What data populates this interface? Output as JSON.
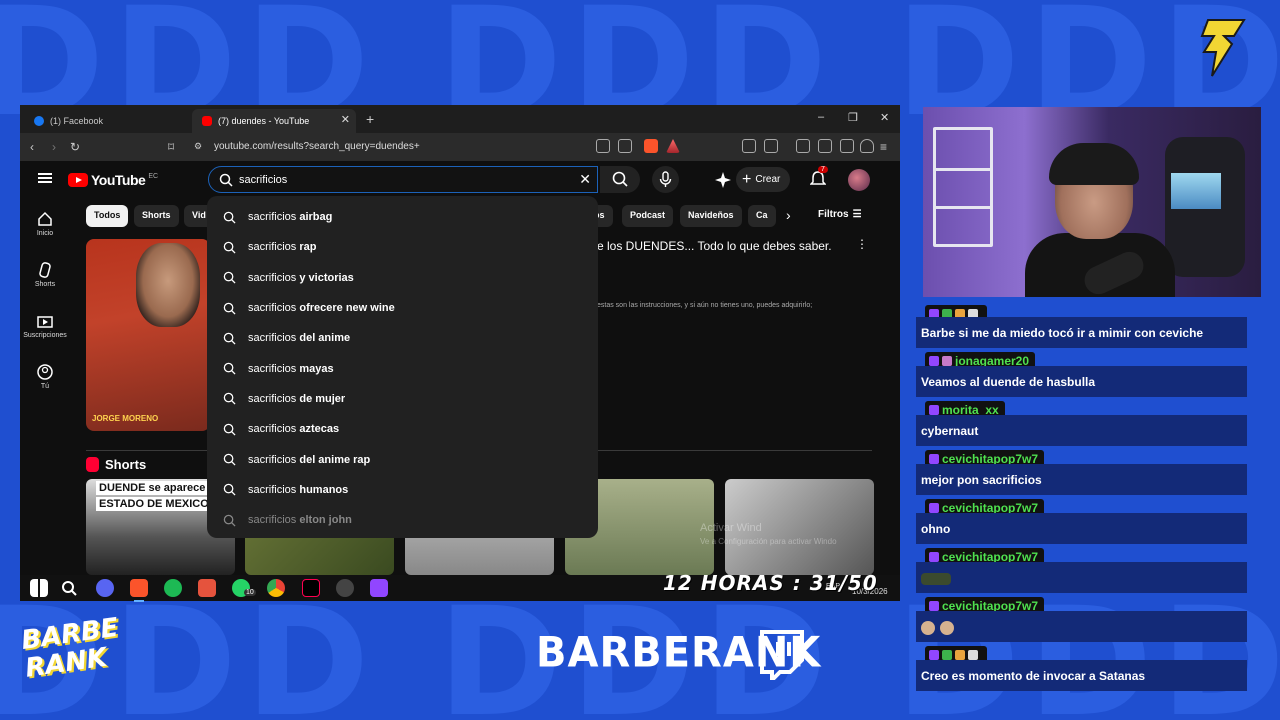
{
  "overlay": {
    "brand_name": "BARBERANK",
    "logo_line1": "BARBE",
    "logo_line2": "RANK",
    "bg_pattern": "DDD DDD DDD DDD",
    "accent_color": "#2b5ee0",
    "counter": "12 HORAS : 31/50"
  },
  "browser": {
    "tabs": [
      {
        "label": "(1) Facebook",
        "icon": "facebook-icon"
      },
      {
        "label": "(7) duendes - YouTube",
        "icon": "youtube-icon",
        "active": true
      }
    ],
    "url": "youtube.com/results?search_query=duendes+"
  },
  "youtube": {
    "logo_text": "YouTube",
    "country": "EC",
    "search_value": "sacrificios",
    "create_label": "Crear",
    "notif_count": "7",
    "nav": [
      {
        "label": "Inicio",
        "icon": "home-icon"
      },
      {
        "label": "Shorts",
        "icon": "shorts-icon"
      },
      {
        "label": "Suscripciones",
        "icon": "subscriptions-icon"
      },
      {
        "label": "Tú",
        "icon": "you-icon"
      }
    ],
    "chips": [
      "Todos",
      "Shorts",
      "Vid",
      "os",
      "Podcast",
      "Navideños",
      "Ca"
    ],
    "filters_label": "Filtros",
    "result_title": "e los DUENDES... Todo lo que debes saber.",
    "result_desc": "estas son las instrucciones, y si aún no tienes uno, puedes adquirirlo;",
    "thumb_caption": "JORGE MORENO",
    "shorts_title": "Shorts",
    "short_caption_1": "DUENDE se aparece",
    "short_caption_2": "ESTADO DE MEXICO",
    "watermark_1": "Activar Wind",
    "watermark_2": "Ve a Configuración para activar Windo",
    "suggestions": [
      {
        "prefix": "sacrificios",
        "suffix": " airbag"
      },
      {
        "prefix": "sacrificios",
        "suffix": " rap"
      },
      {
        "prefix": "sacrificios",
        "suffix": " y victorias"
      },
      {
        "prefix": "sacrificios",
        "suffix": " ofrecere new wine"
      },
      {
        "prefix": "sacrificios",
        "suffix": " del anime"
      },
      {
        "prefix": "sacrificios",
        "suffix": " mayas"
      },
      {
        "prefix": "sacrificios",
        "suffix": " de mujer"
      },
      {
        "prefix": "sacrificios",
        "suffix": " aztecas"
      },
      {
        "prefix": "sacrificios",
        "suffix": " del anime rap"
      },
      {
        "prefix": "sacrificios",
        "suffix": " humanos"
      },
      {
        "prefix": "sacrificios",
        "suffix": " elton john"
      }
    ]
  },
  "taskbar": {
    "lang": "ESP",
    "date": "10/3/2026",
    "whatsapp_badge": "10"
  },
  "chat": [
    {
      "user": "",
      "text": "Barbe si me da miedo tocó ir a mimir con ceviche"
    },
    {
      "user": "jonagamer20",
      "text": "Veamos al duende de hasbulla"
    },
    {
      "user": "morita_xx",
      "text": "cybernaut"
    },
    {
      "user": "cevichitapop7w7",
      "text": "mejor pon sacrificios"
    },
    {
      "user": "cevichitapop7w7",
      "text": "ohno"
    },
    {
      "user": "cevichitapop7w7",
      "text": ""
    },
    {
      "user": "cevichitapop7w7",
      "text": ""
    },
    {
      "user": "",
      "text": "Creo es momento de invocar a Satanas"
    }
  ]
}
